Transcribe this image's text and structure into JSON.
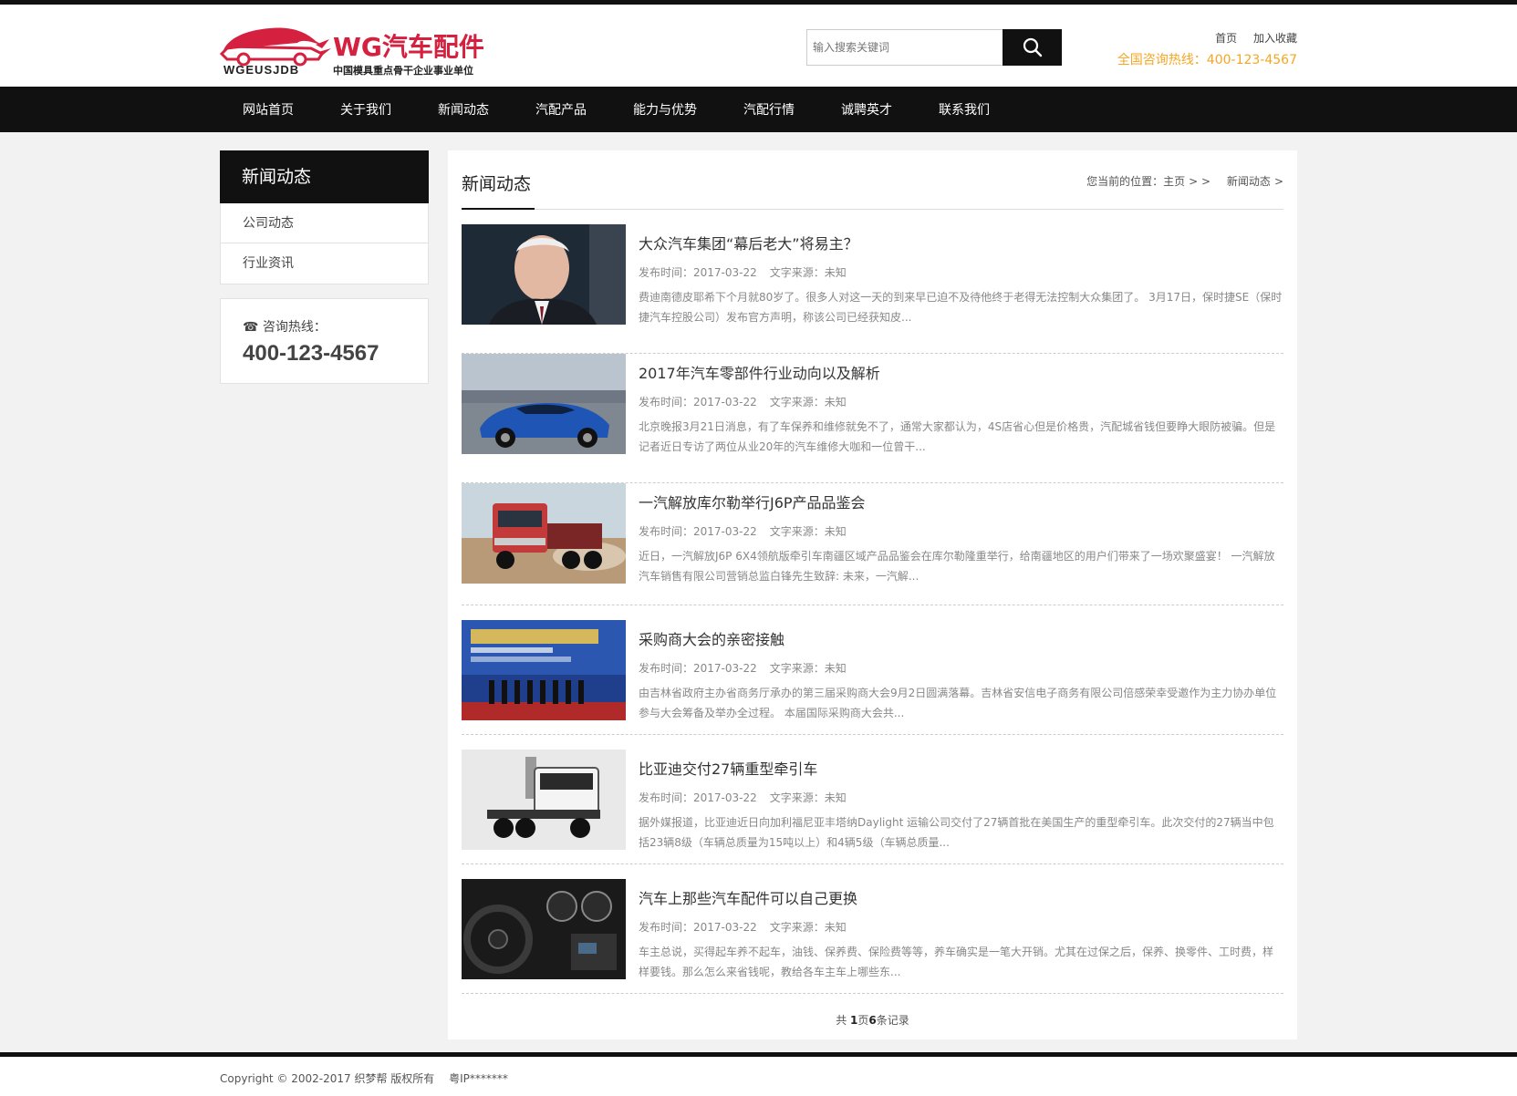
{
  "header": {
    "logo_brand": "WG汽车配件",
    "logo_badge": "WG",
    "logo_sub_en": "WGEUSJDB",
    "logo_sub_cn": "中国模具重点骨干企业事业单位",
    "search_placeholder": "输入搜索关键词",
    "link_home": "首页",
    "link_favorite": "加入收藏",
    "hotline": "全国咨询热线：400-123-4567"
  },
  "nav": [
    "网站首页",
    "关于我们",
    "新闻动态",
    "汽配产品",
    "能力与优势",
    "汽配行情",
    "诚聘英才",
    "联系我们"
  ],
  "sidebar": {
    "title": "新闻动态",
    "items": [
      "公司动态",
      "行业资讯"
    ],
    "contact_label": "咨询热线：",
    "contact_number": "400-123-4567"
  },
  "content": {
    "title": "新闻动态",
    "breadcrumb_prefix": "您当前的位置：",
    "breadcrumb_home": "主页",
    "breadcrumb_sep1": "> >",
    "breadcrumb_current": "新闻动态",
    "breadcrumb_sep2": ">",
    "news": [
      {
        "title": "大众汽车集团“幕后老大”将易主？",
        "date": "发布时间：2017-03-22",
        "source": "文字来源：未知",
        "desc": "费迪南德皮耶希下个月就80岁了。很多人对这一天的到来早已迫不及待他终于老得无法控制大众集团了。 3月17日，保时捷SE（保时捷汽车控股公司）发布官方声明，称该公司已经获知皮...",
        "thumb": "portrait"
      },
      {
        "title": "2017年汽车零部件行业动向以及解析",
        "date": "发布时间：2017-03-22",
        "source": "文字来源：未知",
        "desc": "北京晚报3月21日消息，有了车保养和维修就免不了，通常大家都认为，4S店省心但是价格贵，汽配城省钱但要睁大眼防被骗。但是记者近日专访了两位从业20年的汽车维修大咖和一位曾干...",
        "thumb": "sportscar"
      },
      {
        "title": "一汽解放库尔勒举行J6P产品品鉴会",
        "date": "发布时间：2017-03-22",
        "source": "文字来源：未知",
        "desc": "近日，一汽解放J6P 6X4领航版牵引车南疆区域产品品鉴会在库尔勒隆重举行，给南疆地区的用户们带来了一场欢聚盛宴！ 一汽解放汽车销售有限公司营销总监白锋先生致辞: 未来，一汽解...",
        "thumb": "truck"
      },
      {
        "title": "采购商大会的亲密接触",
        "date": "发布时间：2017-03-22",
        "source": "文字来源：未知",
        "desc": "由吉林省政府主办省商务厅承办的第三届采购商大会9月2日圆满落幕。吉林省安信电子商务有限公司倍感荣幸受邀作为主力协办单位参与大会筹备及举办全过程。 本届国际采购商大会共...",
        "thumb": "conference"
      },
      {
        "title": "比亚迪交付27辆重型牵引车",
        "date": "发布时间：2017-03-22",
        "source": "文字来源：未知",
        "desc": "据外媒报道，比亚迪近日向加利福尼亚丰塔纳Daylight 运输公司交付了27辆首批在美国生产的重型牵引车。此次交付的27辆当中包括23辆8级（车辆总质量为15吨以上）和4辆5级（车辆总质量...",
        "thumb": "tractor"
      },
      {
        "title": "汽车上那些汽车配件可以自己更换",
        "date": "发布时间：2017-03-22",
        "source": "文字来源：未知",
        "desc": "车主总说，买得起车养不起车，油钱、保养费、保险费等等，养车确实是一笔大开销。尤其在过保之后，保养、换零件、工时费，样样要钱。那么怎么来省钱呢，教给各车主车上哪些东...",
        "thumb": "interior"
      }
    ],
    "pager_pre": "共 ",
    "pager_pages": "1",
    "pager_mid": "页",
    "pager_records": "6",
    "pager_post": "条记录"
  },
  "footer": {
    "copyright": "Copyright © 2002-2017 织梦帮 版权所有",
    "icp": "粤IP*******"
  },
  "colors": {
    "brand_red": "#d6203f",
    "hotline_orange": "#f5a623",
    "nav_bg": "#111111"
  }
}
